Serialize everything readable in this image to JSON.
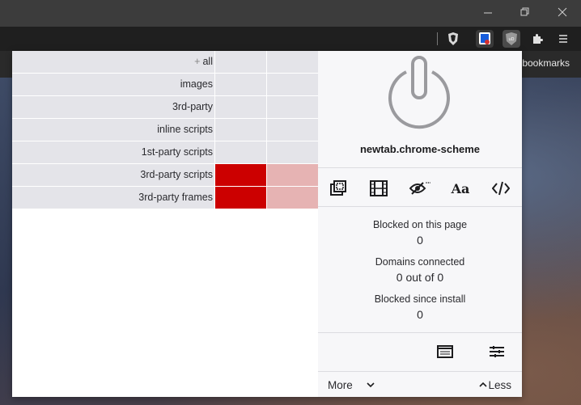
{
  "browser": {
    "bookmarks_label": "bookmarks",
    "window_controls": [
      "minimize-icon",
      "restore-icon",
      "close-icon"
    ],
    "toolbar_icons": [
      "brave-shield-icon",
      "bitwarden-icon",
      "ublock-icon",
      "extensions-puzzle-icon",
      "menu-icon"
    ]
  },
  "firewall": {
    "all_prefix": "+",
    "rows": [
      {
        "label": "all",
        "blocked": false
      },
      {
        "label": "images",
        "blocked": false
      },
      {
        "label": "3rd-party",
        "blocked": false
      },
      {
        "label": "inline scripts",
        "blocked": false
      },
      {
        "label": "1st-party scripts",
        "blocked": false
      },
      {
        "label": "3rd-party scripts",
        "blocked": true
      },
      {
        "label": "3rd-party frames",
        "blocked": true
      }
    ]
  },
  "panel": {
    "hostname": "newtab.chrome-scheme",
    "tools": [
      "popup-blocker-icon",
      "media-icon",
      "cosmetic-filter-icon",
      "fonts-icon",
      "javascript-icon"
    ],
    "fonts_label": "Aa",
    "blocked_page_label": "Blocked on this page",
    "blocked_page_value": "0",
    "domains_label": "Domains connected",
    "domains_value": "0 out of 0",
    "blocked_install_label": "Blocked since install",
    "blocked_install_value": "0",
    "more_label": "More",
    "less_label": "Less"
  },
  "colors": {
    "blocked_local": "#cc0000",
    "blocked_global": "#e6b3b3",
    "row_bg": "#e4e4e9"
  }
}
